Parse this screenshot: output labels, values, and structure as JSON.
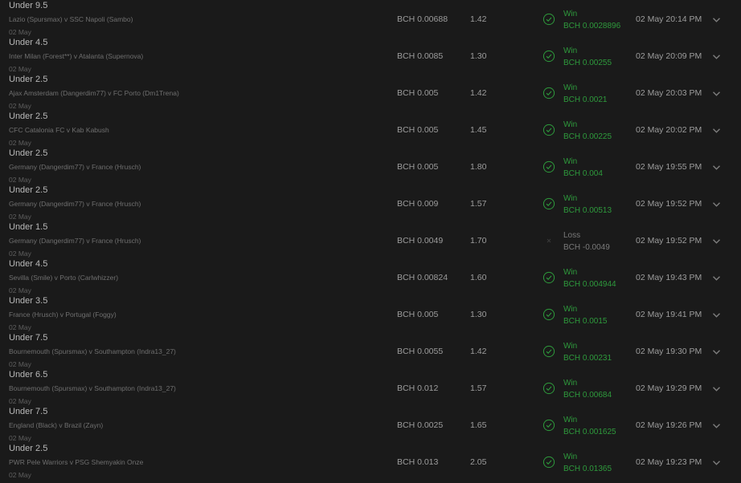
{
  "colors": {
    "background": "#1a1a1a",
    "win": "#2e9a3c",
    "loss": "#7a7a7a"
  },
  "bets": [
    {
      "market": "Under 9.5",
      "event": "Lazio (Spursmax) v SSC Napoli (Sambo)",
      "date": "02 May",
      "stake": "BCH 0.00688",
      "odds": "1.42",
      "result": "Win",
      "payout": "BCH 0.0028896",
      "time": "02 May 20:14 PM",
      "icon": "check-circle-icon"
    },
    {
      "market": "Under 4.5",
      "event": "Inter Milan (Forest**) v Atalanta (Supernova)",
      "date": "02 May",
      "stake": "BCH 0.0085",
      "odds": "1.30",
      "result": "Win",
      "payout": "BCH 0.00255",
      "time": "02 May 20:09 PM",
      "icon": "check-circle-icon"
    },
    {
      "market": "Under 2.5",
      "event": "Ajax Amsterdam (Dangerdim77) v FC Porto (Dm1Trena)",
      "date": "02 May",
      "stake": "BCH 0.005",
      "odds": "1.42",
      "result": "Win",
      "payout": "BCH 0.0021",
      "time": "02 May 20:03 PM",
      "icon": "check-circle-icon"
    },
    {
      "market": "Under 2.5",
      "event": "CFC Catalonia FC v Kab Kabush",
      "date": "02 May",
      "stake": "BCH 0.005",
      "odds": "1.45",
      "result": "Win",
      "payout": "BCH 0.00225",
      "time": "02 May 20:02 PM",
      "icon": "check-circle-icon"
    },
    {
      "market": "Under 2.5",
      "event": "Germany (Dangerdim77) v France (Hrusch)",
      "date": "02 May",
      "stake": "BCH 0.005",
      "odds": "1.80",
      "result": "Win",
      "payout": "BCH 0.004",
      "time": "02 May 19:55 PM",
      "icon": "check-circle-icon"
    },
    {
      "market": "Under 2.5",
      "event": "Germany (Dangerdim77) v France (Hrusch)",
      "date": "02 May",
      "stake": "BCH 0.009",
      "odds": "1.57",
      "result": "Win",
      "payout": "BCH 0.00513",
      "time": "02 May 19:52 PM",
      "icon": "check-circle-icon"
    },
    {
      "market": "Under 1.5",
      "event": "Germany (Dangerdim77) v France (Hrusch)",
      "date": "02 May",
      "stake": "BCH 0.0049",
      "odds": "1.70",
      "result": "Loss",
      "payout": "BCH -0.0049",
      "time": "02 May 19:52 PM",
      "icon": "x-icon"
    },
    {
      "market": "Under 4.5",
      "event": "Sevilla (Smile) v Porto (Carlwhizzer)",
      "date": "02 May",
      "stake": "BCH 0.00824",
      "odds": "1.60",
      "result": "Win",
      "payout": "BCH 0.004944",
      "time": "02 May 19:43 PM",
      "icon": "check-circle-icon"
    },
    {
      "market": "Under 3.5",
      "event": "France (Hrusch) v Portugal (Foggy)",
      "date": "02 May",
      "stake": "BCH 0.005",
      "odds": "1.30",
      "result": "Win",
      "payout": "BCH 0.0015",
      "time": "02 May 19:41 PM",
      "icon": "check-circle-icon"
    },
    {
      "market": "Under 7.5",
      "event": "Bournemouth (Spursmax) v Southampton (Indra13_27)",
      "date": "02 May",
      "stake": "BCH 0.0055",
      "odds": "1.42",
      "result": "Win",
      "payout": "BCH 0.00231",
      "time": "02 May 19:30 PM",
      "icon": "check-circle-icon"
    },
    {
      "market": "Under 6.5",
      "event": "Bournemouth (Spursmax) v Southampton (Indra13_27)",
      "date": "02 May",
      "stake": "BCH 0.012",
      "odds": "1.57",
      "result": "Win",
      "payout": "BCH 0.00684",
      "time": "02 May 19:29 PM",
      "icon": "check-circle-icon"
    },
    {
      "market": "Under 7.5",
      "event": "England (Black) v Brazil (Zayn)",
      "date": "02 May",
      "stake": "BCH 0.0025",
      "odds": "1.65",
      "result": "Win",
      "payout": "BCH 0.001625",
      "time": "02 May 19:26 PM",
      "icon": "check-circle-icon"
    },
    {
      "market": "Under 2.5",
      "event": "PWR Pele Warriors v PSG Shemyakin Onze",
      "date": "02 May",
      "stake": "BCH 0.013",
      "odds": "2.05",
      "result": "Win",
      "payout": "BCH 0.01365",
      "time": "02 May 19:23 PM",
      "icon": "check-circle-icon"
    }
  ]
}
